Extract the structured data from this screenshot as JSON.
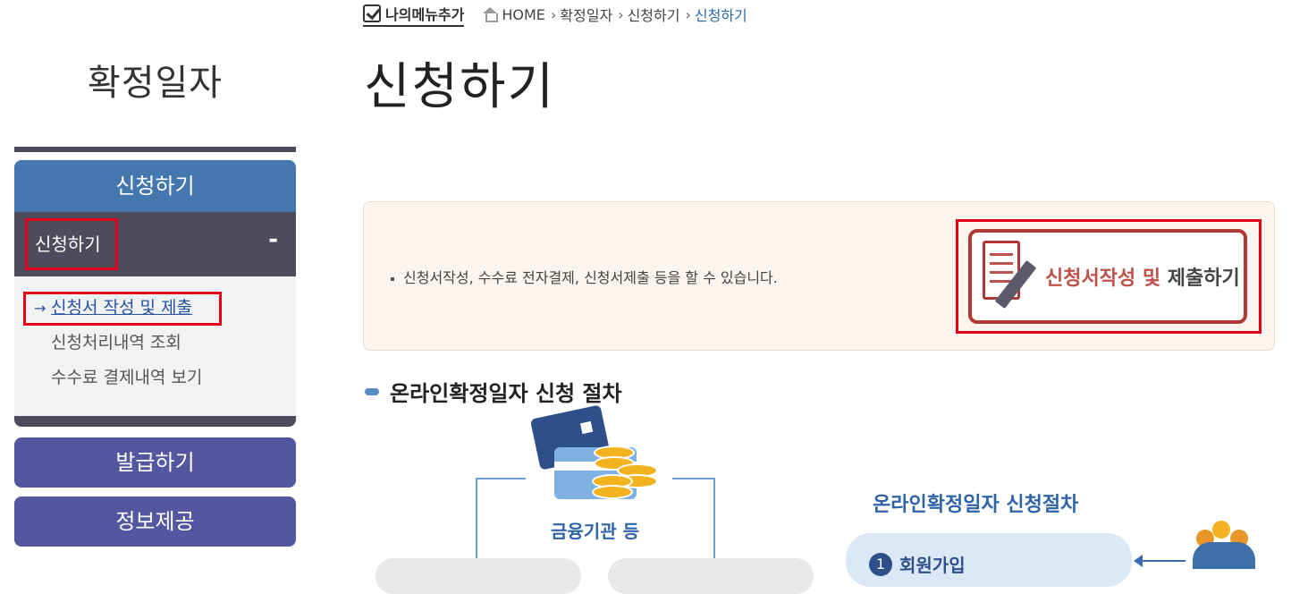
{
  "sidebar": {
    "title": "확정일자",
    "section_head": "신청하기",
    "sub_head": "신청하기",
    "collapse_symbol": "-",
    "links": [
      {
        "label": "신청서 작성 및 제출",
        "active": true
      },
      {
        "label": "신청처리내역 조회",
        "active": false
      },
      {
        "label": "수수료 결제내역 보기",
        "active": false
      }
    ],
    "menus": [
      {
        "label": "발급하기"
      },
      {
        "label": "정보제공"
      }
    ]
  },
  "header": {
    "my_menu_label": "나의메뉴추가",
    "breadcrumb": [
      "HOME",
      "확정일자",
      "신청하기",
      "신청하기"
    ]
  },
  "main": {
    "page_title": "신청하기",
    "info_text": "신청서작성, 수수료 전자결제, 신청서제출 등을 할 수 있습니다.",
    "apply_button": {
      "label_part1": "신청서작성 및",
      "label_part2": "제출하기"
    },
    "section_title": "온라인확정일자 신청 절차",
    "illustration": {
      "finance_label": "금융기관 등",
      "process_title": "온라인확정일자 신청절차",
      "step_number": "1",
      "step_label": "회원가입"
    }
  },
  "colors": {
    "sidebar_head": "#4377ae",
    "sidebar_sub": "#4e4b5c",
    "sidebar_menu": "#5257a0",
    "highlight": "#e3001b",
    "apply_accent": "#c0504a",
    "breadcrumb_current": "#2a6bb0"
  }
}
